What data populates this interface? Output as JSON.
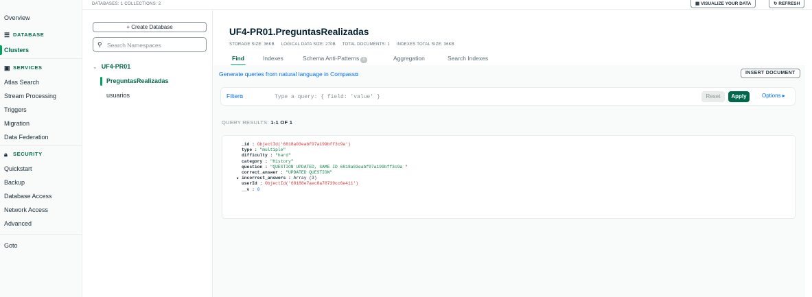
{
  "nav": {
    "overview": "Overview",
    "database_section": "DATABASE",
    "clusters": "Clusters",
    "services_section": "SERVICES",
    "atlas_search": "Atlas Search",
    "stream_processing": "Stream Processing",
    "triggers": "Triggers",
    "migration": "Migration",
    "data_federation": "Data Federation",
    "security_section": "SECURITY",
    "quickstart": "Quickstart",
    "backup": "Backup",
    "database_access": "Database Access",
    "network_access": "Network Access",
    "advanced": "Advanced",
    "goto": "Goto"
  },
  "topbar": {
    "stats": "DATABASES: 1  COLLECTIONS: 2",
    "visualize_label": "VISUALIZE YOUR DATA",
    "refresh_label": "REFRESH"
  },
  "namespaces": {
    "create_label": "+ Create Database",
    "search_placeholder": "Search Namespaces",
    "database": "UF4-PR01",
    "collections": [
      "PreguntasRealizadas",
      "usuarios"
    ]
  },
  "collection": {
    "title": "UF4-PR01.PreguntasRealizadas",
    "storage_size": "STORAGE SIZE: 36KB",
    "logical_size": "LOGICAL DATA SIZE: 270B",
    "total_documents": "TOTAL DOCUMENTS: 1",
    "indexes_size": "INDEXES TOTAL SIZE: 36KB"
  },
  "tabs": [
    "Find",
    "Indexes",
    "Schema Anti-Patterns",
    "Aggregation",
    "Search Indexes"
  ],
  "schema_badge": "0",
  "find": {
    "generate_link": "Generate queries from natural language in Compass",
    "insert_label": "INSERT DOCUMENT",
    "filter_label": "Filter",
    "filter_placeholder": "Type a query: { field: 'value' }",
    "reset_label": "Reset",
    "apply_label": "Apply",
    "options_label": "Options ▸",
    "results_prefix": "QUERY RESULTS:",
    "results_range": "1-1 OF 1"
  },
  "document": [
    {
      "key": "_id",
      "value": "ObjectId('6818a03eabf97a199bff3c9a')",
      "kind": "oid"
    },
    {
      "key": "type",
      "value": "\"multiple\"",
      "kind": "str"
    },
    {
      "key": "difficulty",
      "value": "\"hard\"",
      "kind": "str"
    },
    {
      "key": "category",
      "value": "\"History\"",
      "kind": "str"
    },
    {
      "key": "question",
      "value": "\"QUESTION UPDATED, SAME ID 6818a03eabf97a199bff3c9a \"",
      "kind": "str"
    },
    {
      "key": "correct_answer",
      "value": "\"UPDATED QUESTION\"",
      "kind": "str"
    },
    {
      "key": "incorrect_answers",
      "value": "Array (3)",
      "kind": "arr"
    },
    {
      "key": "userId",
      "value": "ObjectId('68188e7aec8a78739cc6e411')",
      "kind": "oid"
    },
    {
      "key": "__v",
      "value": "0",
      "kind": "num"
    }
  ]
}
